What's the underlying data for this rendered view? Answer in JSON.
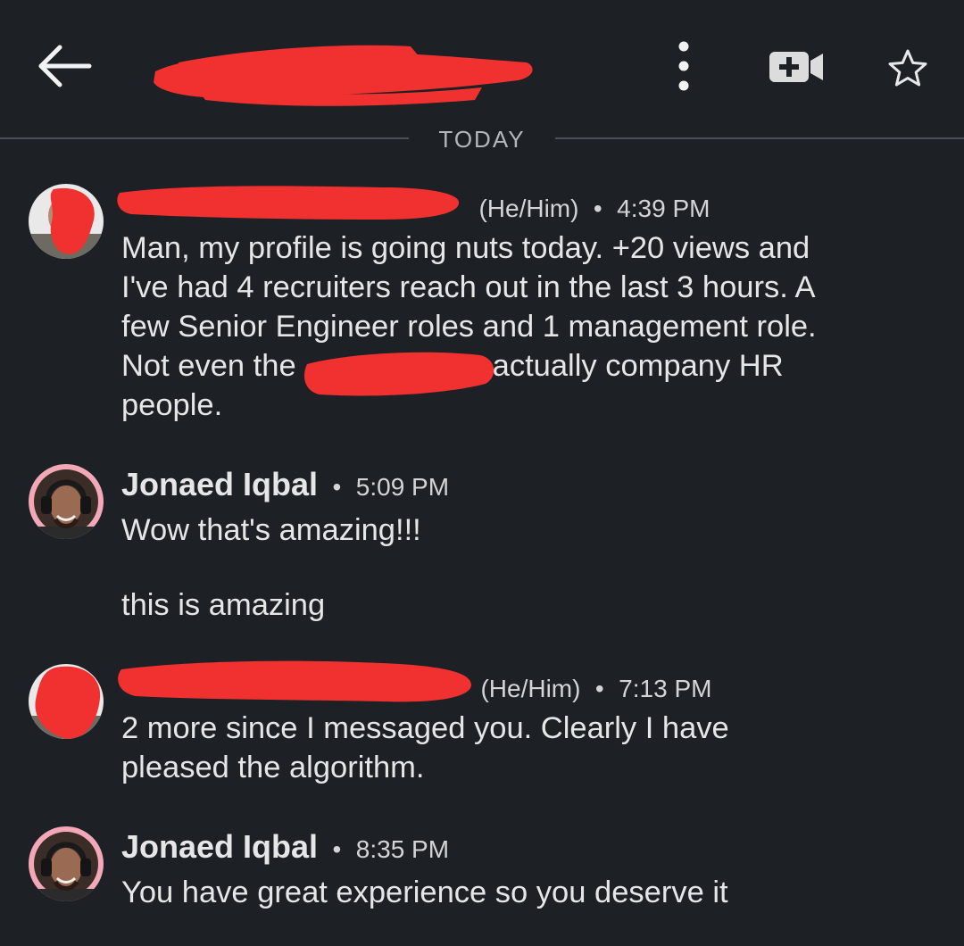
{
  "header": {
    "back_icon": "arrow-left-icon",
    "more_icon": "vertical-dots-icon",
    "video_icon": "video-call-add-icon",
    "star_icon": "star-outline-icon"
  },
  "divider": {
    "label": "TODAY"
  },
  "colors": {
    "background": "#1d2126",
    "text": "#e6e6e6",
    "secondary_text": "#d2d4d6",
    "divider_line": "#4b5058",
    "redaction": "#f0312f",
    "avatar_ring": "#f3a8b8"
  },
  "messages": [
    {
      "sender": "",
      "pronouns": "(He/Him)",
      "time": "4:39 PM",
      "lines": [
        "Man, my profile is going nuts today. +20 views and",
        "I've had 4 recruiters reach out in the last 3 hours. A",
        "few Senior Engineer roles and 1 management role.",
        "Not even the",
        "actually company HR",
        "people."
      ]
    },
    {
      "sender": "Jonaed Iqbal",
      "time": "5:09 PM",
      "lines": [
        "Wow that's amazing!!!",
        "this is amazing"
      ]
    },
    {
      "sender": "",
      "pronouns": "(He/Him)",
      "time": "7:13 PM",
      "lines": [
        "2 more since I messaged you. Clearly I have",
        "pleased the algorithm."
      ]
    },
    {
      "sender": "Jonaed Iqbal",
      "time": "8:35 PM",
      "lines": [
        "You have great experience so you deserve it"
      ]
    }
  ]
}
